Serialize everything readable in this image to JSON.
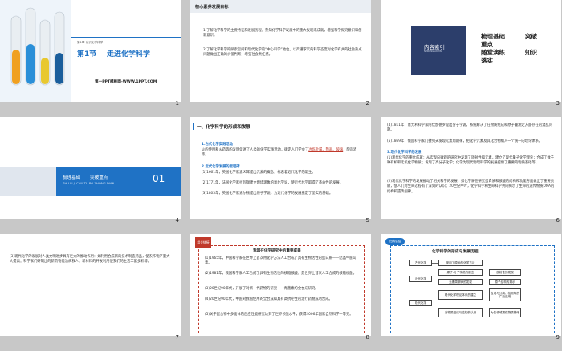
{
  "slides": [
    {
      "number": "1",
      "section_tag": "第1章  认识化学科学",
      "title_num": "第1节",
      "title": "走进化学科学",
      "website": "第一PPT模板网-WWW.1PPT.COM"
    },
    {
      "number": "2",
      "heading": "核心素养发展目标",
      "goal1": "1.了解化学科学的主要特征和发展历程，熟知化学科学发展中的重大发现或成就，增强科学探究意识和创新意识。",
      "goal2": "2.了解化学科学的探索空间和现代化学的“中心科学”地位，以严谨求实的科学态度对化学有关的社会热点问题做出正确的价值判断，增强社会责任感。"
    },
    {
      "number": "3",
      "tab": "内容索引",
      "tab_sub": "NEIRONGSUOYIN",
      "items": [
        "梳理基础",
        "突破",
        "重点",
        "随堂演练",
        "知识",
        "落实"
      ]
    },
    {
      "number": "4",
      "name": "梳理基础",
      "name2": "突破重点",
      "pinyin": "SHU LI JI CHU  TU PO ZHONG DIAN",
      "index": "01"
    },
    {
      "number": "5",
      "heading": "一、化学科学的形成和发展",
      "p1": "1.古代化学实践活动",
      "p2a": "火的使用和火药等的发明促进了人类的化学实践活动，确定人们学会了",
      "p2b": "冶炼金属、陶器、玻璃",
      "p2c": "，酿造酒等。",
      "p3": "2.近代化学发展的里程碑",
      "p4": "(1)1661年，英国化学家波义耳提出元素的概念，标志着近代化学的诞生。",
      "p5": "(2)1771年，法国化学家拉瓦锡建立燃烧现象的氧化学说，使近代化学取得了革命性的发展。",
      "p6": "(3)1803年，英国化学家道尔顿提出原子学说，为近代化学的发展奠定了坚实的基础。"
    },
    {
      "number": "6",
      "p1": "(4)1811年，意大利科学家阿伏加德罗提出分子学说，系统解决了在物质组成和原子量测定方面存在的混乱问题。",
      "p2": "(5)1869年，俄国科学家门捷列夫发现元素周期律，把化学元素及其化合物纳入一个统一的理论体系。",
      "p3": "3.现代化学科学的发展",
      "p4": "(1)现代化学的重大成就：从宏观向微观的研究中发现了放射性和元素，建立了现代量子化学理论；合成了数千种有机和无机化学物质；发现了高分子化学；化学为现代物理科学的发展提供了重要的物质基础等。",
      "p5": "(2)现代化学科学的发展推动了相关科学的发展：如化学家在研究蛋白质和核酸的结构和功能方面做出了重要贡献，使人们对生命过程有了深刻的认识；20世纪中叶，化学科学和生命科学共同揭示了生命的遗传物质DNA的结构和遗传规律。"
    },
    {
      "number": "7",
      "text": "(3)现代化学的发展对人类文明进步具有巨大的推动作用：如利用合成新的技术制造药品，使农作物产量大大提高；科学家们研制出的新药物能治病救人；新材料的开发利用使我们的生活丰富多彩等。"
    },
    {
      "number": "8",
      "tag": "相关链接",
      "title": "我国在化学研究中的重要成果",
      "items": [
        "(1)1965年，中国科学家在世界上首次用化学方法人工合成了具有生物活性的蛋白质——结晶牛胰岛素。",
        "(2)1981年，我国科学家人工合成了具有生物活性的核糖核酸，是世界上首次人工合成的核糖核酸。",
        "(3)20世纪90年代，开展了对新一代药物的研究——青蒿素的全合成研究。",
        "(4)20世纪90年代，中国对我国使用的全合成和具有高抗疟性的治疗药物成功合成。",
        "(5)关于配合物中多面体的反应性能研究达到了世界领先水平，获得2006年国家自然科学一等奖。"
      ]
    },
    {
      "number": "9",
      "tag": "归纳总结",
      "title": "化学科学的形成与发展历程",
      "nodes": [
        "古代化学",
        "近代化学",
        "现代化学",
        "采用了原始的化学方法",
        "原子-分子学说的建立",
        "放射性的发现",
        "元素周期律的发现",
        "原子结构的揭示",
        "现代化学理论体系的建立",
        "合成与分离、检测等的广泛应用",
        "对物质组成与结构的认识",
        "为各领域提供物质基础"
      ]
    }
  ],
  "colors": {
    "accent": "#1f72c5",
    "dark": "#2c3e6b",
    "red": "#c0392b"
  }
}
